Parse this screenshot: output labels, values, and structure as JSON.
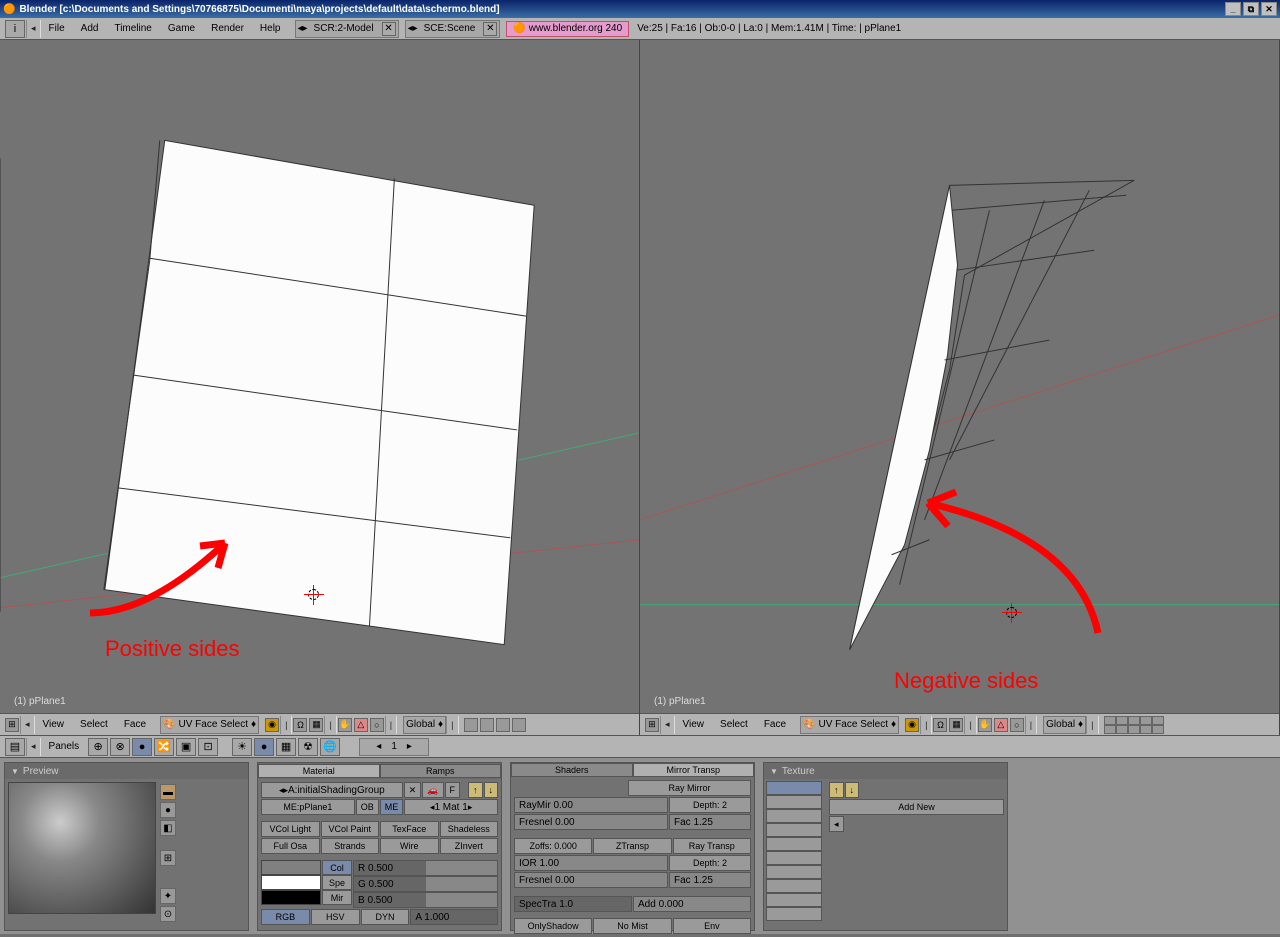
{
  "title": "Blender [c:\\Documents and Settings\\70766875\\Documenti\\maya\\projects\\default\\data\\schermo.blend]",
  "menu": {
    "file": "File",
    "add": "Add",
    "timeline": "Timeline",
    "game": "Game",
    "render": "Render",
    "help": "Help"
  },
  "scr": {
    "label": "SCR:2-Model"
  },
  "sce": {
    "label": "SCE:Scene"
  },
  "url": "www.blender.org 240",
  "stats": "Ve:25 | Fa:16 | Ob:0-0 | La:0 | Mem:1.41M | Time: | pPlane1",
  "vp": {
    "view": "View",
    "select": "Select",
    "face": "Face",
    "mode": "UV Face Select",
    "orient": "Global",
    "caption": "(1) pPlane1"
  },
  "annotations": {
    "left": "Positive sides",
    "right": "Negative sides"
  },
  "panelsLbl": "Panels",
  "frame": "1",
  "preview": {
    "title": "Preview"
  },
  "material": {
    "tab1": "Material",
    "tab2": "Ramps",
    "mat": "A:initialShadingGroup",
    "me": "ME:pPlane1",
    "ob": "OB",
    "meBtn": "ME",
    "matcount": "1 Mat 1",
    "vcollight": "VCol Light",
    "vcolpaint": "VCol Paint",
    "texface": "TexFace",
    "shadeless": "Shadeless",
    "fullosa": "Full Osa",
    "strands": "Strands",
    "wire": "Wire",
    "zinvert": "ZInvert",
    "col": "Col",
    "spe": "Spe",
    "mir": "Mir",
    "r": "R 0.500",
    "g": "G 0.500",
    "b": "B 0.500",
    "rgb": "RGB",
    "hsv": "HSV",
    "dyn": "DYN",
    "a": "A 1.000"
  },
  "shaders": {
    "tab1": "Shaders",
    "tab2": "Mirror Transp",
    "raymirror": "Ray Mirror",
    "raymir": "RayMir 0.00",
    "depth1": "Depth: 2",
    "fresnel1": "Fresnel 0.00",
    "fac1": "Fac 1.25",
    "zoffs": "Zoffs: 0.000",
    "ztransp": "ZTransp",
    "raytransp": "Ray Transp",
    "ior": "IOR 1.00",
    "depth2": "Depth: 2",
    "fresnel2": "Fresnel 0.00",
    "fac2": "Fac 1.25",
    "spectra": "SpecTra 1.0",
    "add": "Add 0.000",
    "onlyshadow": "OnlyShadow",
    "nomist": "No Mist",
    "env": "Env"
  },
  "texture": {
    "title": "Texture",
    "addnew": "Add New"
  }
}
